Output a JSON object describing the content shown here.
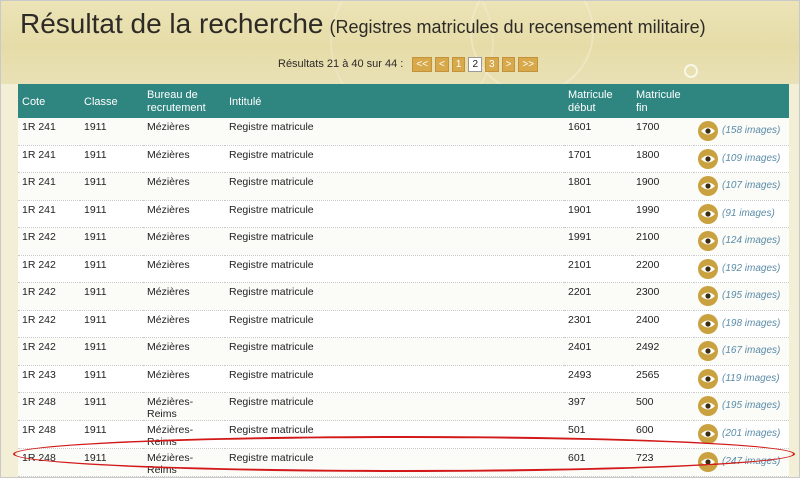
{
  "header": {
    "title": "Résultat de la recherche",
    "subtitle": "(Registres matricules du recensement militaire)"
  },
  "pager": {
    "info": "Résultats 21 à 40 sur 44 :",
    "first": "<<",
    "prev": "<",
    "page1": "1",
    "page2": "2",
    "page3": "3",
    "next": ">",
    "last": ">>"
  },
  "table": {
    "headers": {
      "cote": "Cote",
      "classe": "Classe",
      "bureau": "Bureau de recrutement",
      "intitule": "Intitulé",
      "matricule_debut": "Matricule début",
      "matricule_fin": "Matricule fin"
    },
    "rows": [
      {
        "cote": "1R 241",
        "classe": "1911",
        "bureau": "Mézières",
        "intitule": "Registre matricule",
        "debut": "1601",
        "fin": "1700",
        "images": "(158 images)"
      },
      {
        "cote": "1R 241",
        "classe": "1911",
        "bureau": "Mézières",
        "intitule": "Registre matricule",
        "debut": "1701",
        "fin": "1800",
        "images": "(109 images)"
      },
      {
        "cote": "1R 241",
        "classe": "1911",
        "bureau": "Mézières",
        "intitule": "Registre matricule",
        "debut": "1801",
        "fin": "1900",
        "images": "(107 images)"
      },
      {
        "cote": "1R 241",
        "classe": "1911",
        "bureau": "Mézières",
        "intitule": "Registre matricule",
        "debut": "1901",
        "fin": "1990",
        "images": "(91 images)"
      },
      {
        "cote": "1R 242",
        "classe": "1911",
        "bureau": "Mézières",
        "intitule": "Registre matricule",
        "debut": "1991",
        "fin": "2100",
        "images": "(124 images)"
      },
      {
        "cote": "1R 242",
        "classe": "1911",
        "bureau": "Mézières",
        "intitule": "Registre matricule",
        "debut": "2101",
        "fin": "2200",
        "images": "(192 images)"
      },
      {
        "cote": "1R 242",
        "classe": "1911",
        "bureau": "Mézières",
        "intitule": "Registre matricule",
        "debut": "2201",
        "fin": "2300",
        "images": "(195 images)"
      },
      {
        "cote": "1R 242",
        "classe": "1911",
        "bureau": "Mézières",
        "intitule": "Registre matricule",
        "debut": "2301",
        "fin": "2400",
        "images": "(198 images)"
      },
      {
        "cote": "1R 242",
        "classe": "1911",
        "bureau": "Mézières",
        "intitule": "Registre matricule",
        "debut": "2401",
        "fin": "2492",
        "images": "(167 images)"
      },
      {
        "cote": "1R 243",
        "classe": "1911",
        "bureau": "Mézières",
        "intitule": "Registre matricule",
        "debut": "2493",
        "fin": "2565",
        "images": "(119 images)"
      },
      {
        "cote": "1R 248",
        "classe": "1911",
        "bureau": "Mézières-Reims",
        "intitule": "Registre matricule",
        "debut": "397",
        "fin": "500",
        "images": "(195 images)"
      },
      {
        "cote": "1R 248",
        "classe": "1911",
        "bureau": "Mézières-Reims",
        "intitule": "Registre matricule",
        "debut": "501",
        "fin": "600",
        "images": "(201 images)"
      },
      {
        "cote": "1R 248",
        "classe": "1911",
        "bureau": "Mézières-Reims",
        "intitule": "Registre matricule",
        "debut": "601",
        "fin": "723",
        "images": "(247 images)"
      }
    ]
  },
  "icons": {
    "view": "eye-icon"
  },
  "colors": {
    "header_bg": "#2f8580",
    "pager_button": "#d8a94a",
    "eye_button": "#c9a13e",
    "image_count": "#5a8ca8",
    "highlight": "#d21a1a"
  }
}
